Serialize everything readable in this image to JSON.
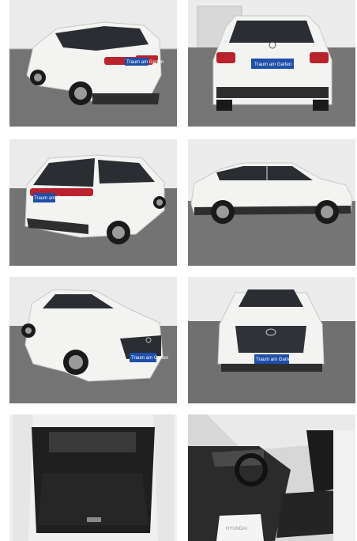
{
  "gallery": {
    "photos": [
      {
        "id": "rear-left-three-quarter",
        "plate_text": "Traum am Garten"
      },
      {
        "id": "rear",
        "plate_text": "Traum am Garten"
      },
      {
        "id": "rear-left-high",
        "plate_text": "Traum am Garten"
      },
      {
        "id": "side-right",
        "plate_text": ""
      },
      {
        "id": "front-left-three-quarter",
        "plate_text": "Traum am Garten"
      },
      {
        "id": "front",
        "plate_text": "Traum am Garten"
      },
      {
        "id": "trunk",
        "plate_text": ""
      },
      {
        "id": "interior-driver",
        "mat_text": "HYUNDAI"
      }
    ],
    "colors": {
      "paint": "#f3f3f1",
      "floor": "#6f6f6f",
      "wall": "#e9e9e9",
      "plate": "#1f4fa8"
    }
  }
}
